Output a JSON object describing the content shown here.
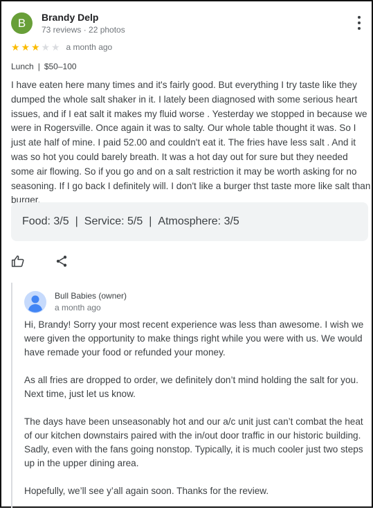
{
  "review": {
    "avatar_letter": "B",
    "author": "Brandy Delp",
    "meta": "73 reviews · 22 photos",
    "rating": 3,
    "rating_max": 5,
    "date": "a month ago",
    "meal": "Lunch",
    "separator": "|",
    "price": "$50–100",
    "text": "I have eaten here many times and it's fairly good. But everything I try taste like they dumped the whole salt shaker in it. I lately been diagnosed with some serious heart issues, and if I eat salt it makes my fluid worse . Yesterday we stopped in because we were in Rogersville. Once again it was to salty. Our whole table thought it was. So I just ate half of mine. I paid 52.00 and couldn't eat it. The fries have less salt . And it was so hot you could barely breath. It was a hot day out for sure but they needed some air flowing. So if you go and on a salt restriction it may be worth asking for no seasoning. If I go back I definitely will. I don't like a burger thst taste more like salt than burger.",
    "scores": {
      "food": "Food: 3/5",
      "service": "Service: 5/5",
      "atmosphere": "Atmosphere: 3/5",
      "divider": "|"
    }
  },
  "actions": {
    "like_icon": "thumbs-up-icon",
    "share_icon": "share-icon"
  },
  "owner_response": {
    "name": "Bull Babies (owner)",
    "date": "a month ago",
    "avatar_icon": "person-icon",
    "paragraphs": [
      "Hi, Brandy! Sorry your most recent experience was less than awesome. I wish we were given the opportunity to make things right while you were with us. We would have remade your food or refunded your money.",
      "As all fries are dropped to order, we definitely don’t mind holding the salt for you. Next time, just let us know.",
      "The days have been unseasonably hot and our a/c unit just can’t combat the heat of our kitchen downstairs paired with the in/out door traffic in our historic building. Sadly, even with the fans going nonstop. Typically, it is much cooler just two steps up in the upper dining area.",
      "Hopefully, we’ll see y’all again soon. Thanks for the review."
    ]
  },
  "colors": {
    "avatar": "#689f38",
    "star_on": "#fbbc04",
    "star_off": "#dadce0",
    "score_bg": "#f1f3f4"
  }
}
